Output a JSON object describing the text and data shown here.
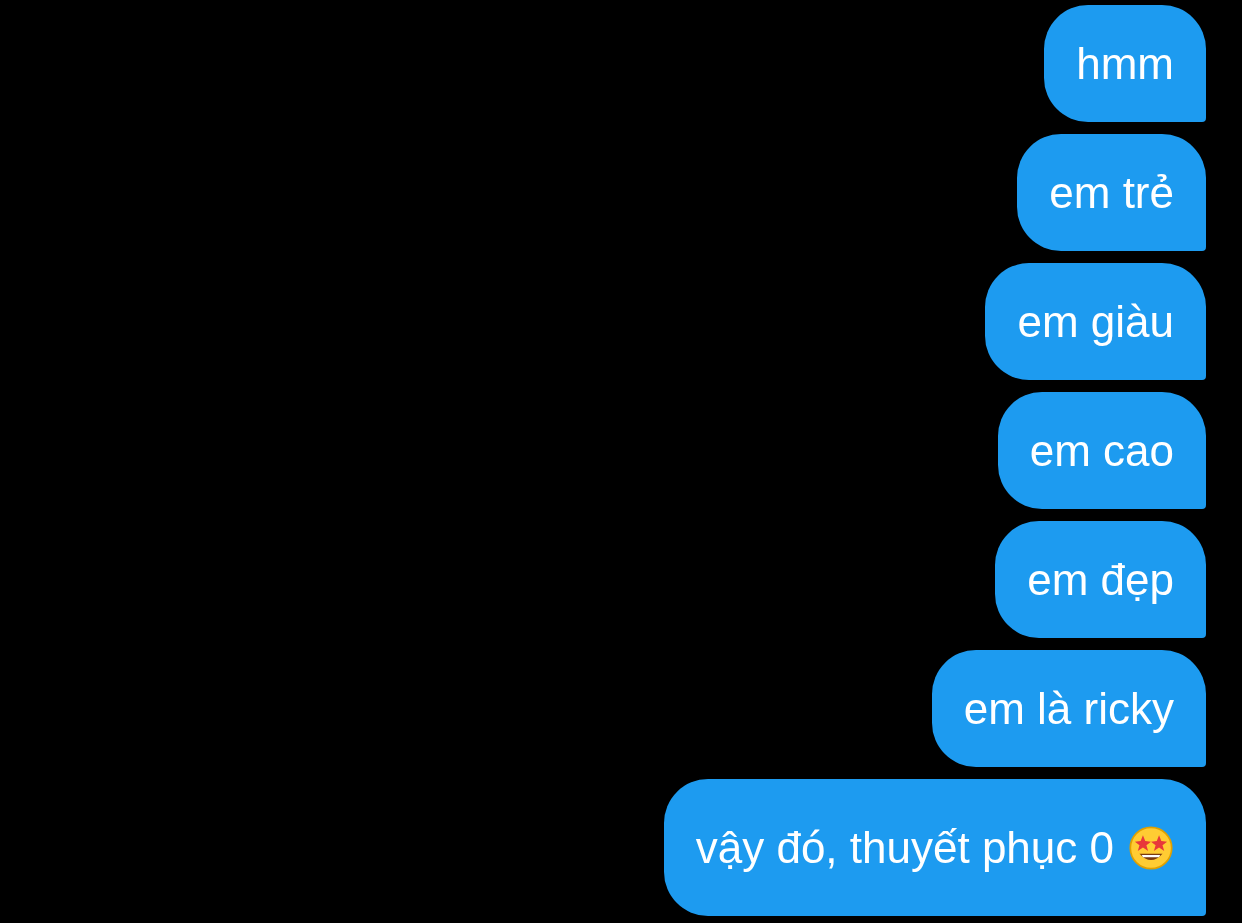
{
  "messages": [
    {
      "text": "hmm",
      "emoji": false
    },
    {
      "text": "em trẻ",
      "emoji": false
    },
    {
      "text": "em giàu",
      "emoji": false
    },
    {
      "text": "em cao",
      "emoji": false
    },
    {
      "text": "em đẹp",
      "emoji": false
    },
    {
      "text": "em là ricky",
      "emoji": false
    },
    {
      "text": "vậy đó, thuyết phục 0",
      "emoji": true
    }
  ]
}
